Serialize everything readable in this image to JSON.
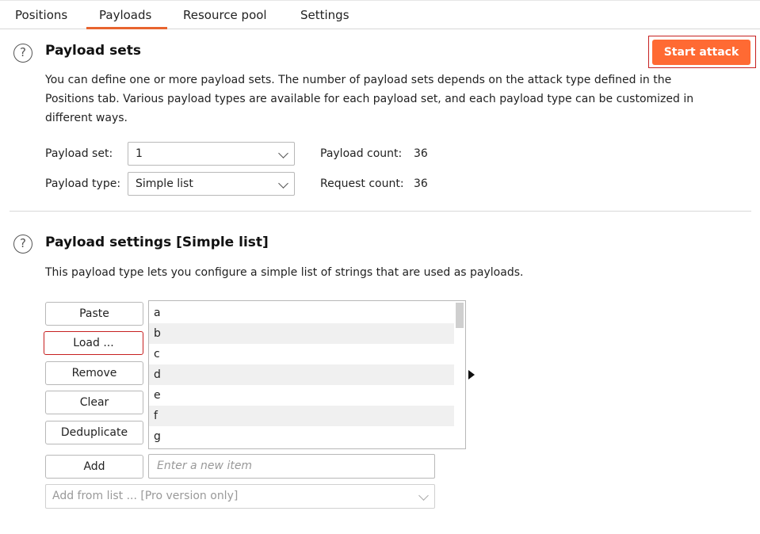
{
  "tabs": [
    {
      "label": "Positions"
    },
    {
      "label": "Payloads"
    },
    {
      "label": "Resource pool"
    },
    {
      "label": "Settings"
    }
  ],
  "active_tab": "Payloads",
  "payload_sets": {
    "title": "Payload sets",
    "help_glyph": "?",
    "description": "You can define one or more payload sets. The number of payload sets depends on the attack type defined in the Positions tab. Various payload types are available for each payload set, and each payload type can be customized in different ways.",
    "description_lines": [
      "You can define one or more payload sets. The number of payload sets depends on the attack type defined in the",
      "Positions tab. Various payload types are available for each payload set, and each payload type can be customized in",
      "different ways."
    ],
    "set_label": "Payload set:",
    "set_value": "1",
    "type_label": "Payload type:",
    "type_value": "Simple list",
    "payload_count_label": "Payload count:",
    "payload_count": "36",
    "request_count_label": "Request count:",
    "request_count": "36"
  },
  "start_attack_label": "Start attack",
  "accent_color": "#ff6a33",
  "payload_settings": {
    "title": "Payload settings [Simple list]",
    "help_glyph": "?",
    "description": "This payload type lets you configure a simple list of strings that are used as payloads.",
    "buttons": {
      "paste": "Paste",
      "load": "Load ...",
      "remove": "Remove",
      "clear": "Clear",
      "deduplicate": "Deduplicate",
      "add": "Add"
    },
    "items": [
      "a",
      "b",
      "c",
      "d",
      "e",
      "f",
      "g"
    ],
    "new_item_placeholder": "Enter a new item",
    "add_from_list": "Add from list ... [Pro version only]"
  }
}
